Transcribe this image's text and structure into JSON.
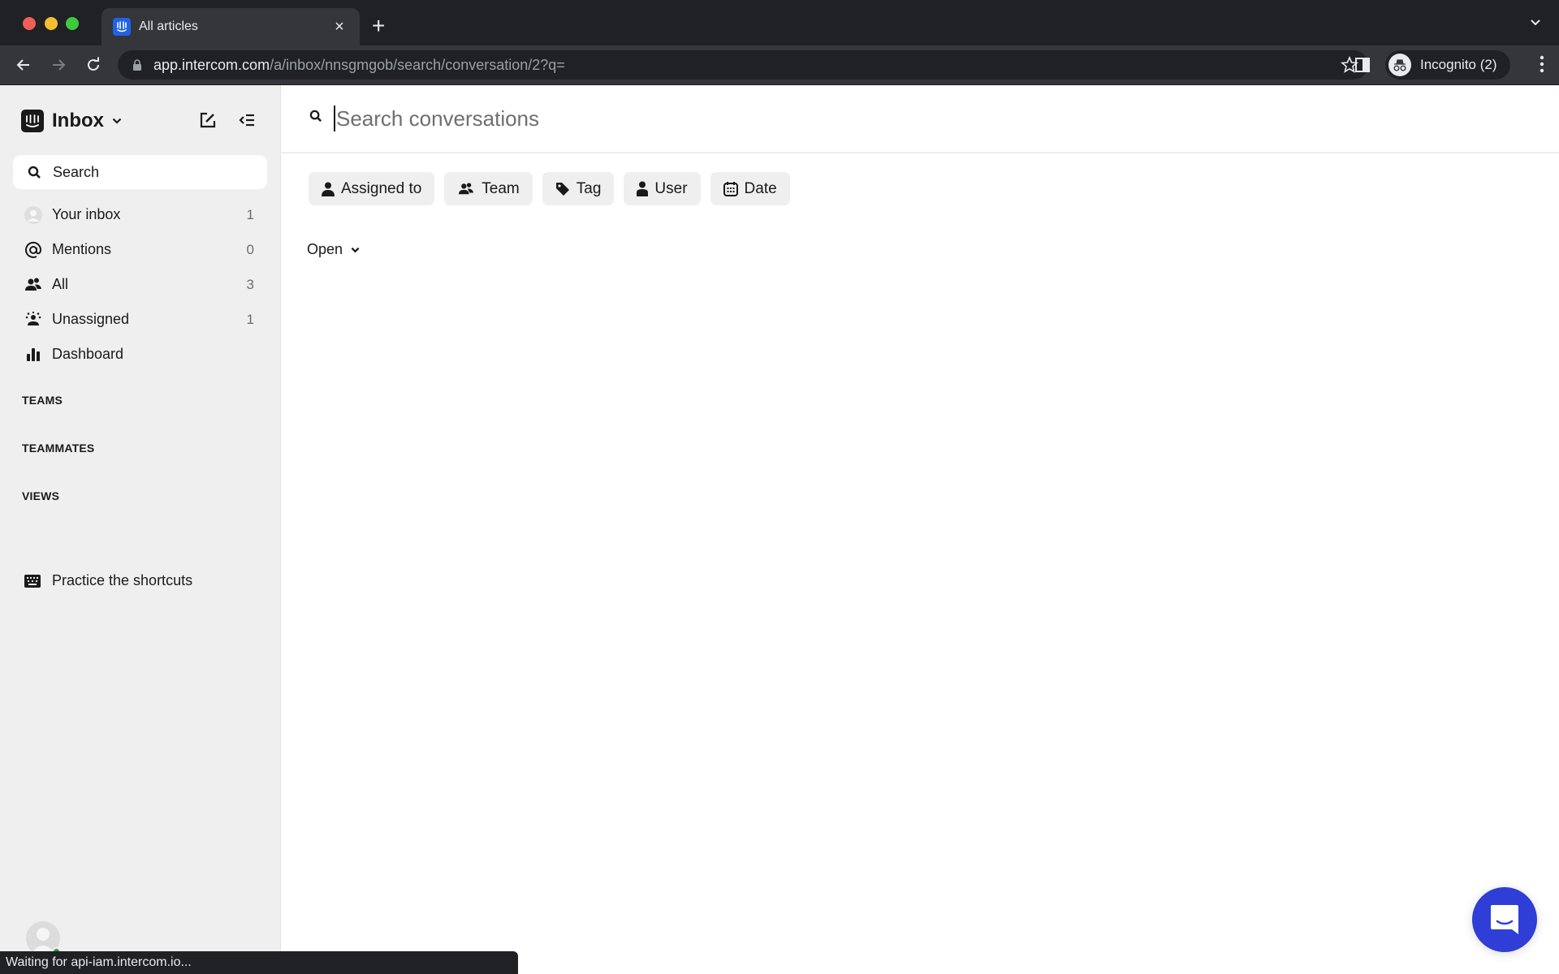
{
  "browser": {
    "tab_title": "All articles",
    "url_host": "app.intercom.com",
    "url_path": "/a/inbox/nnsgmgob/search/conversation/2?q=",
    "profile_label": "Incognito (2)",
    "status_text": "Waiting for api-iam.intercom.io..."
  },
  "sidebar": {
    "title": "Inbox",
    "search_label": "Search",
    "items": [
      {
        "label": "Your inbox",
        "count": "1",
        "icon": "avatar-icon"
      },
      {
        "label": "Mentions",
        "count": "0",
        "icon": "at-icon"
      },
      {
        "label": "All",
        "count": "3",
        "icon": "people-icon"
      },
      {
        "label": "Unassigned",
        "count": "1",
        "icon": "unassigned-icon"
      },
      {
        "label": "Dashboard",
        "count": "",
        "icon": "bar-chart-icon"
      }
    ],
    "sections": [
      "TEAMS",
      "TEAMMATES",
      "VIEWS"
    ],
    "shortcuts_label": "Practice the shortcuts"
  },
  "main": {
    "search_placeholder": "Search conversations",
    "search_value": "",
    "filters": [
      {
        "label": "Assigned to",
        "icon": "person-icon"
      },
      {
        "label": "Team",
        "icon": "team-icon"
      },
      {
        "label": "Tag",
        "icon": "tag-icon"
      },
      {
        "label": "User",
        "icon": "user-icon"
      },
      {
        "label": "Date",
        "icon": "calendar-icon"
      }
    ],
    "status_filter": "Open"
  },
  "colors": {
    "messenger_accent": "#2e3ed6",
    "favicon": "#2161e6",
    "online": "#1d9f3c"
  }
}
